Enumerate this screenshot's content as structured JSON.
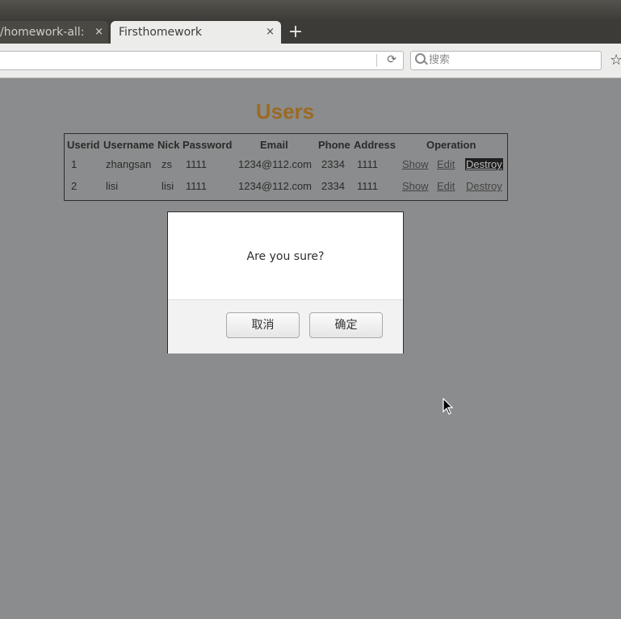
{
  "browser": {
    "tabs": [
      {
        "title": "/homework-all:",
        "active": false
      },
      {
        "title": "Firsthomework",
        "active": true
      }
    ],
    "tab_close_glyph": "×",
    "new_tab_glyph": "+",
    "search_placeholder": "搜索",
    "reload_glyph": "⟳",
    "bookmark_glyph": "☆"
  },
  "page": {
    "title": "Users",
    "table": {
      "headers": [
        "Userid",
        "Username",
        "Nick",
        "Password",
        "Email",
        "Phone",
        "Address",
        "Operation"
      ],
      "rows": [
        {
          "userid": "1",
          "username": "zhangsan",
          "nick": "zs",
          "password": "1111",
          "email": "1234@112.com",
          "phone": "2334",
          "address": "1111",
          "show": "Show",
          "edit": "Edit",
          "destroy": "Destroy"
        },
        {
          "userid": "2",
          "username": "lisi",
          "nick": "lisi",
          "password": "1111",
          "email": "1234@112.com",
          "phone": "2334",
          "address": "1111",
          "show": "Show",
          "edit": "Edit",
          "destroy": "Destroy"
        }
      ]
    }
  },
  "dialog": {
    "message": "Are you sure?",
    "cancel_label": "取消",
    "ok_label": "确定"
  },
  "colors": {
    "title": "#9b6a22",
    "page_background": "#8b8c8d",
    "selected_link_bg": "#1f1f1f"
  }
}
